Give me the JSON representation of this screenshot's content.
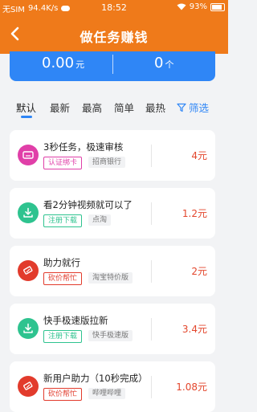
{
  "status_bar": {
    "carrier": "无SIM",
    "speed": "94.4K/s",
    "time": "18:52",
    "battery": "93%"
  },
  "header": {
    "title": "做任务赚钱"
  },
  "summary": {
    "left_value": "0.00",
    "left_unit": "元",
    "right_value": "0",
    "right_unit": "个"
  },
  "tabs": [
    "默认",
    "最新",
    "最高",
    "简单",
    "最热"
  ],
  "filter_label": "筛选",
  "colors": {
    "brand_orange": "#ef7a1a",
    "accent_blue": "#2f86f6",
    "reward_red": "#e3462c"
  },
  "tasks": [
    {
      "title": "3秒任务，极速审核",
      "tag": "认证绑卡",
      "platform": "招商银行",
      "reward": "4元",
      "icon": "card-icon",
      "tag_color": "#e03fa8",
      "icon_color": "#e03fa8"
    },
    {
      "title": "看2分钟视频就可以了",
      "tag": "注册下载",
      "platform": "点淘",
      "reward": "1.2元",
      "icon": "download-icon",
      "tag_color": "#2ec38f",
      "icon_color": "#2ec38f"
    },
    {
      "title": "助力就行",
      "tag": "砍价帮忙",
      "platform": "淘宝特价版",
      "reward": "2元",
      "icon": "cut-icon",
      "tag_color": "#e23b2c",
      "icon_color": "#e23b2c"
    },
    {
      "title": "快手极速版拉新",
      "tag": "注册下载",
      "platform": "快手极速版",
      "reward": "3.4元",
      "icon": "download-icon",
      "tag_color": "#2ec38f",
      "icon_color": "#2ec38f"
    },
    {
      "title": "新用户助力（10秒完成）",
      "tag": "砍价帮忙",
      "platform": "哔哩哔哩",
      "reward": "1.08元",
      "icon": "cut-icon",
      "tag_color": "#e23b2c",
      "icon_color": "#e23b2c"
    }
  ]
}
